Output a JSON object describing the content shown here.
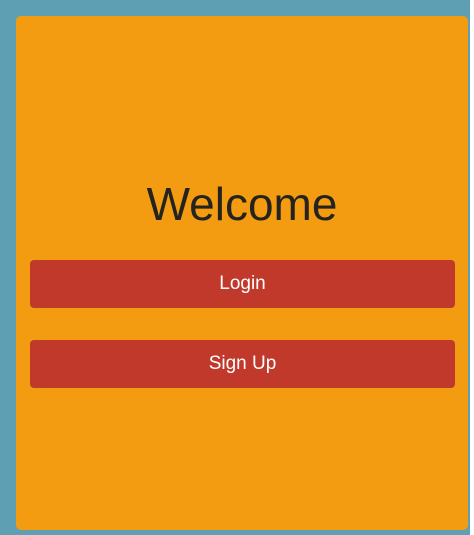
{
  "welcome": {
    "title": "Welcome",
    "login_label": "Login",
    "signup_label": "Sign Up"
  },
  "colors": {
    "page_border": "#5f9fb3",
    "card_background": "#f39c12",
    "button_background": "#c0392b",
    "button_text": "#ffffff",
    "title_text": "#25231e"
  }
}
